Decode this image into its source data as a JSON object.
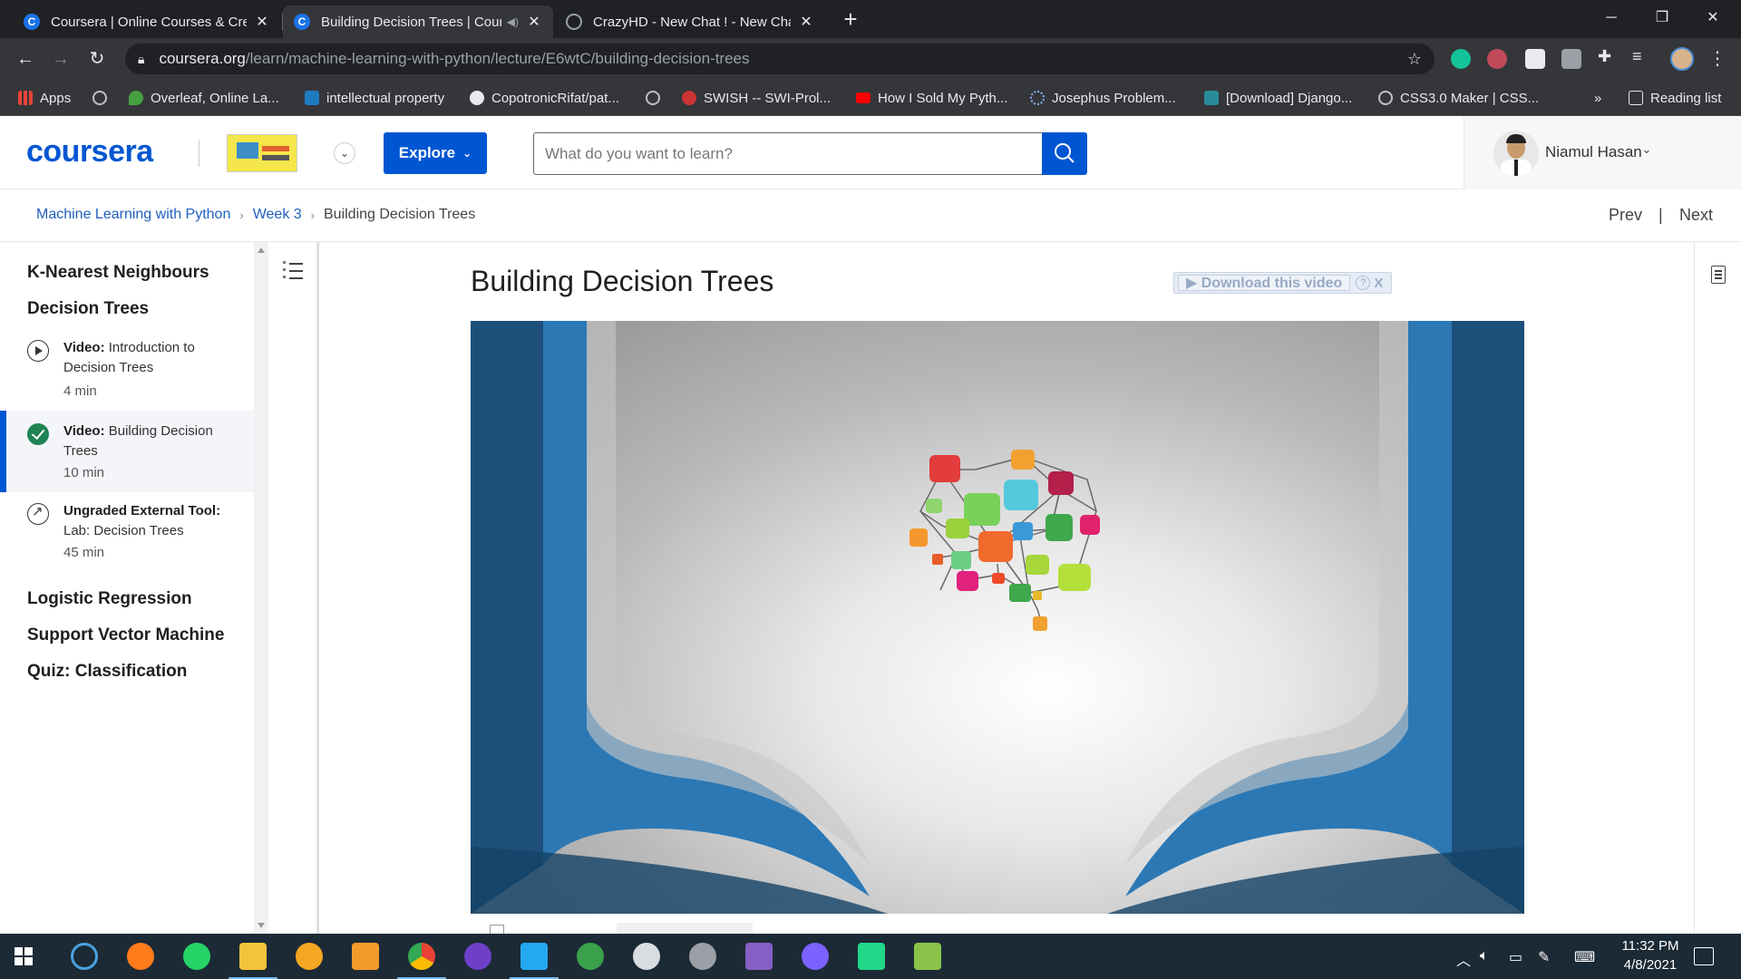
{
  "browser": {
    "tabs": [
      {
        "title": "Coursera | Online Courses & Credentials",
        "favicon": "coursera-icon",
        "active": false
      },
      {
        "title": "Building Decision Trees | Coursera",
        "favicon": "coursera-icon",
        "active": true
      },
      {
        "title": "CrazyHD - New Chat ! - New Chat",
        "favicon": "globe-icon",
        "active": false
      }
    ],
    "new_tab_label": "+",
    "url_host": "coursera.org",
    "url_path": "/learn/machine-learning-with-python/lecture/E6wtC/building-decision-trees",
    "bookmarks": [
      {
        "label": "Apps",
        "icon": "apps-grid-icon"
      },
      {
        "label": "",
        "icon": "globe-icon"
      },
      {
        "label": "Overleaf, Online La...",
        "icon": "overleaf-icon"
      },
      {
        "label": "intellectual property",
        "icon": "scribd-icon"
      },
      {
        "label": "CopotronicRifat/pat...",
        "icon": "github-icon"
      },
      {
        "label": "",
        "icon": "globe-icon"
      },
      {
        "label": "SWISH -- SWI-Prol...",
        "icon": "swish-icon"
      },
      {
        "label": "How I Sold My Pyth...",
        "icon": "youtube-icon"
      },
      {
        "label": "Josephus Problem...",
        "icon": "loading-icon"
      },
      {
        "label": "[Download] Django...",
        "icon": "site-icon"
      },
      {
        "label": "CSS3.0 Maker | CSS...",
        "icon": "globe-icon"
      }
    ],
    "bookmarks_overflow": "»",
    "reading_list": "Reading list"
  },
  "header": {
    "logo_text": "coursera",
    "explore_label": "Explore",
    "search_placeholder": "What do you want to learn?",
    "user_name": "Niamul Hasan"
  },
  "breadcrumbs": {
    "course": "Machine Learning with Python",
    "week": "Week 3",
    "current": "Building Decision Trees",
    "sep": "›"
  },
  "nav": {
    "prev": "Prev",
    "divider": "|",
    "next": "Next"
  },
  "sidebar": {
    "modules": [
      "K-Nearest Neighbours",
      "Decision Trees",
      "Logistic Regression",
      "Support Vector Machine",
      "Quiz: Classification"
    ],
    "items": [
      {
        "type_label": "Video:",
        "name": "Introduction to Decision Trees",
        "duration": "4 min",
        "status": "play",
        "active": false
      },
      {
        "type_label": "Video:",
        "name": "Building Decision Trees",
        "duration": "10 min",
        "status": "completed",
        "active": true
      },
      {
        "type_label": "Ungraded External Tool:",
        "name": "Lab: Decision Trees",
        "duration": "45 min",
        "status": "external",
        "active": false
      }
    ]
  },
  "lecture": {
    "title": "Building Decision Trees",
    "download_widget": {
      "label": "▶ Download this video",
      "help": "?",
      "close": "X"
    }
  },
  "taskbar": {
    "apps": [
      "start-icon",
      "search-app-icon",
      "firefox-icon",
      "whatsapp-icon",
      "file-explorer-icon",
      "vpn-icon",
      "photos-app-icon",
      "chrome-icon",
      "github-desktop-icon",
      "vscode-icon",
      "xampp-icon",
      "paint-3d-icon",
      "inkscape-icon",
      "visual-studio-icon",
      "messenger-icon",
      "pycharm-icon",
      "notepad-plus-icon"
    ],
    "time": "11:32 PM",
    "date": "4/8/2021"
  },
  "colors": {
    "brand": "#0056d2",
    "completed": "#1f8354",
    "tab_bar": "#202124",
    "toolbar": "#35363a",
    "taskbar": "#1c2a36"
  }
}
